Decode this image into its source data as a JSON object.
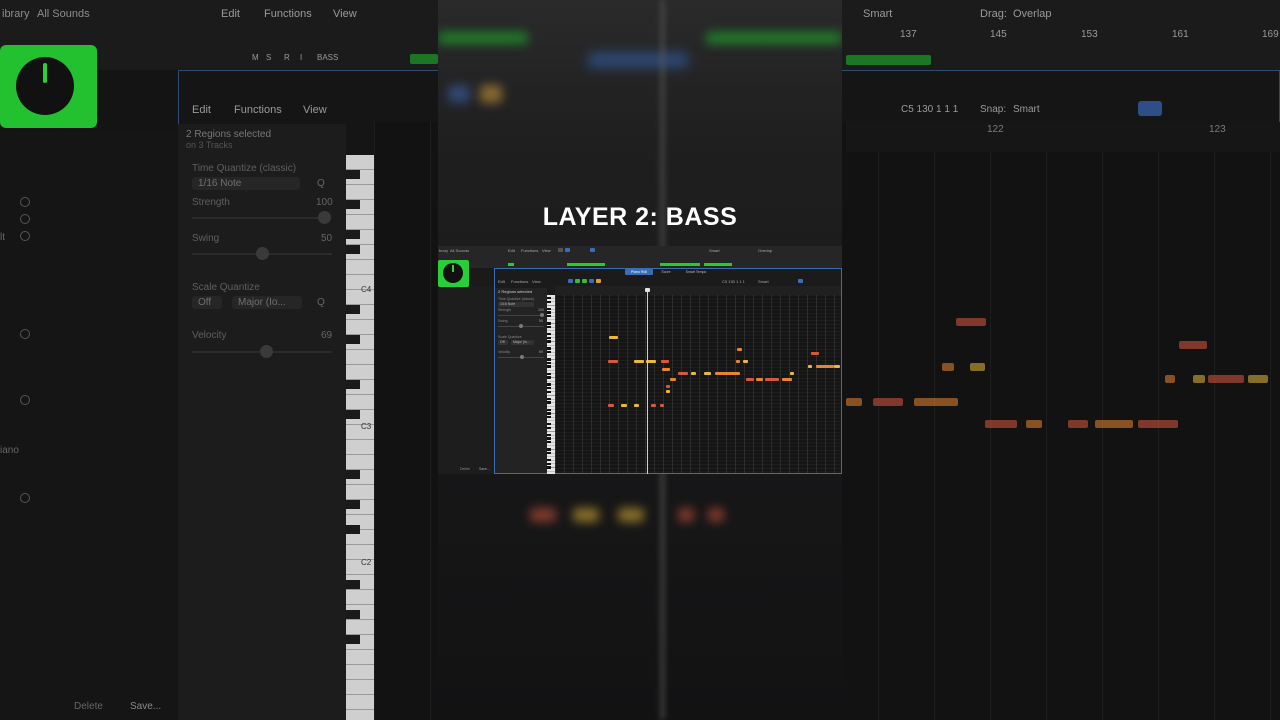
{
  "overlay_title": "LAYER 2: BASS",
  "background": {
    "library_title": "ibrary",
    "library_sound": "All Sounds",
    "top_menu": [
      "Edit",
      "Functions",
      "View"
    ],
    "snap_label": "Smart",
    "drag_label": "Drag:",
    "drag_value": "Overlap",
    "top_bars": [
      "137",
      "145",
      "153",
      "161",
      "169"
    ],
    "track_header": [
      "M",
      "S",
      "R",
      "I",
      "BASS"
    ],
    "editor_menu": [
      "Edit",
      "Functions",
      "View"
    ],
    "position": "C5  130 1 1 1",
    "snap_prefix": "Snap:",
    "snap_value": "Smart",
    "editor_bars": [
      "122",
      "123"
    ],
    "inspector": {
      "selection": "2 Regions selected",
      "selection_sub": "on 3 Tracks",
      "time_quantize_label": "Time Quantize (classic)",
      "time_quantize_value": "1/16 Note",
      "q_button": "Q",
      "strength_label": "Strength",
      "strength_value": "100",
      "swing_label": "Swing",
      "swing_value": "50",
      "scale_quantize_label": "Scale Quantize",
      "scale_off": "Off",
      "scale_mode": "Major (Io...",
      "velocity_label": "Velocity",
      "velocity_value": "69"
    },
    "piano_labels": [
      "C4",
      "C3",
      "C2"
    ],
    "left_labels": [
      "lt",
      "iano"
    ],
    "footer_delete": "Delete",
    "footer_save": "Save..."
  },
  "mini": {
    "library_title": "brary",
    "library_sound": "All Sounds",
    "menu": [
      "Edit",
      "Functions",
      "View"
    ],
    "snap_value": "Smart",
    "drag_value": "Overlap",
    "tabs": [
      "Piano Roll",
      "Score",
      "Smart Tempo"
    ],
    "selection": "2 Regions selected",
    "time_quantize_label": "Time Quantize (classic)",
    "time_quantize_value": "1/16 Note",
    "strength_label": "Strength",
    "strength_value": "100",
    "swing_label": "Swing",
    "swing_value": "50",
    "scale_quantize_label": "Scale Quantize",
    "scale_off": "Off",
    "scale_mode": "Major (Io...",
    "velocity_label": "Velocity",
    "velocity_value": "69",
    "footer_delete": "Delete",
    "footer_save": "Save...",
    "position": "C5   130 1 1 1",
    "snap_editor": "Smart"
  },
  "colors": {
    "accent_green": "#28d037",
    "note_red": "#d9573e",
    "note_orange": "#e9852d",
    "note_yellow": "#e8b93a",
    "selection_blue": "#3a6eb4"
  }
}
